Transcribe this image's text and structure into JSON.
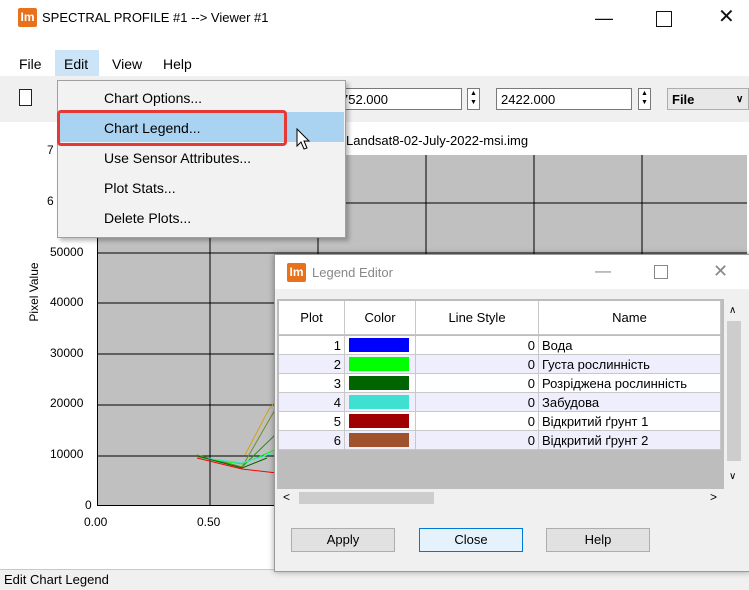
{
  "window": {
    "title": "SPECTRAL PROFILE #1 --> Viewer #1",
    "logo": "Im"
  },
  "menu": {
    "file": "File",
    "edit": "Edit",
    "view": "View",
    "help": "Help"
  },
  "toolbar": {
    "value1": "752.000",
    "value2": "2422.000",
    "select_value": "File"
  },
  "edit_menu": {
    "items": [
      "Chart Options...",
      "Chart Legend...",
      "Use Sensor Attributes...",
      "Plot Stats...",
      "Delete Plots..."
    ]
  },
  "chart": {
    "title_partial": "Landsat8-02-July-2022-msi.img",
    "ylabel": "Pixel Value",
    "y_ticks": [
      "50000",
      "40000",
      "30000",
      "20000",
      "10000",
      "0"
    ],
    "y_ticks_partial": [
      "7",
      "6"
    ],
    "x_ticks": [
      "0.00",
      "0.50"
    ]
  },
  "legend_editor": {
    "logo": "Im",
    "title": "Legend Editor",
    "columns": [
      "Plot",
      "Color",
      "Line Style",
      "Name"
    ],
    "rows": [
      {
        "plot": "1",
        "color": "#0000ff",
        "line_style": "0",
        "name": "Вода"
      },
      {
        "plot": "2",
        "color": "#00ff00",
        "line_style": "0",
        "name": "Густа рослинність"
      },
      {
        "plot": "3",
        "color": "#006400",
        "line_style": "0",
        "name": "Розріджена рослинність"
      },
      {
        "plot": "4",
        "color": "#40e0d0",
        "line_style": "0",
        "name": "Забудова"
      },
      {
        "plot": "5",
        "color": "#a00000",
        "line_style": "0",
        "name": "Відкритий ґрунт 1"
      },
      {
        "plot": "6",
        "color": "#a0522d",
        "line_style": "0",
        "name": "Відкритий ґрунт 2"
      }
    ],
    "buttons": {
      "apply": "Apply",
      "close": "Close",
      "help": "Help"
    }
  },
  "status": {
    "text": "Edit Chart Legend"
  },
  "colors": {
    "accent_logo": "#e8711c",
    "highlight": "#aad3f1",
    "callout": "#e53935"
  }
}
